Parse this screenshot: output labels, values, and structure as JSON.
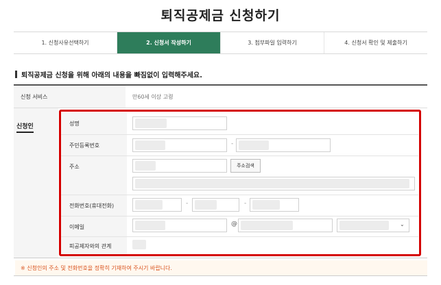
{
  "page": {
    "title": "퇴직공제금 신청하기"
  },
  "steps": [
    {
      "label": "1. 신청사유선택하기",
      "active": false
    },
    {
      "label": "2. 신청서 작성하기",
      "active": true
    },
    {
      "label": "3. 첨부파일 입력하기",
      "active": false
    },
    {
      "label": "4. 신청서 확인 및 제출하기",
      "active": false
    }
  ],
  "notice": "퇴직공제금 신청을 위해 아래의 내용을 빠짐없이 입력해주세요.",
  "service": {
    "label": "신청 서비스",
    "value": "만60세 이상 고령"
  },
  "applicant": {
    "section_label": "신청인",
    "fields": {
      "name": "성명",
      "rrn": "주민등록번호",
      "address": "주소",
      "address_search_button": "주소검색",
      "phone": "전화번호(휴대전화)",
      "email": "이메일",
      "email_at": "@",
      "relation": "피공제자와의 관계"
    },
    "dash": "-"
  },
  "warning": "※ 신청인의 주소 및 전화번호을 정확히 기재하여 주시기 바랍니다.",
  "colors": {
    "active_step": "#2e7d5b",
    "highlight_border": "#d40000",
    "warning_text": "#d9531e"
  }
}
